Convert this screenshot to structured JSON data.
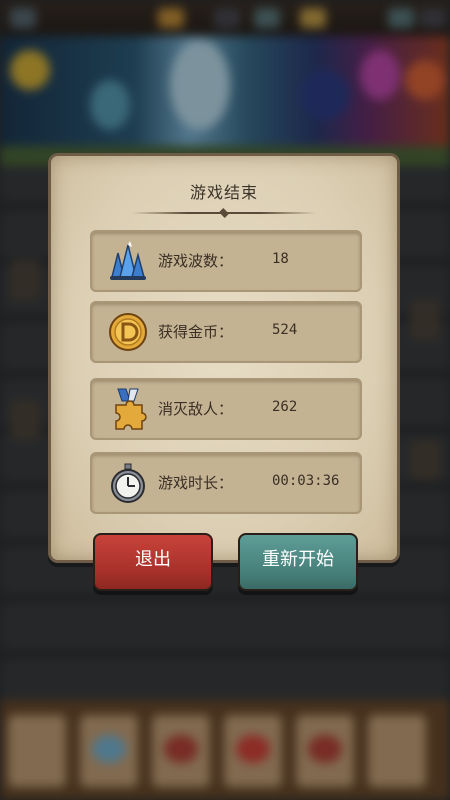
{
  "dialog": {
    "title": "游戏结束",
    "stats": [
      {
        "icon": "blue-crystal-icon",
        "label": "游戏波数：",
        "value": "18"
      },
      {
        "icon": "gold-coin-icon",
        "label": "获得金币：",
        "value": "524"
      },
      {
        "icon": "puzzle-medal-icon",
        "label": "消灭敌人：",
        "value": "262"
      },
      {
        "icon": "stopwatch-icon",
        "label": "游戏时长：",
        "value": "00:03:36"
      }
    ]
  },
  "buttons": {
    "quit_label": "退出",
    "restart_label": "重新开始"
  },
  "colors": {
    "quit": "#b3362e",
    "restart": "#4f8b86",
    "paper": "#dfd3b9"
  }
}
